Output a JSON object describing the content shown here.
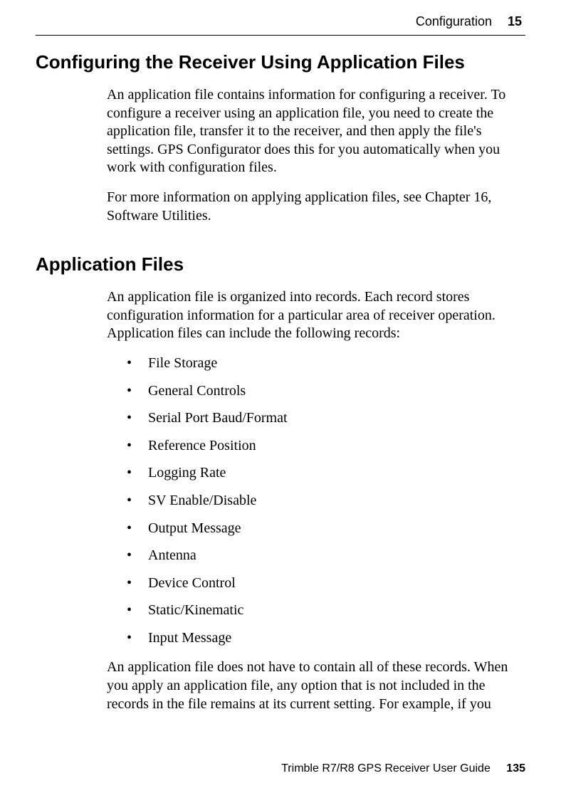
{
  "header": {
    "section": "Configuration",
    "chapter": "15"
  },
  "heading1": "Configuring the Receiver Using Application Files",
  "para1": "An application file contains information for configuring a receiver. To configure a receiver using an application file, you need to create the application file, transfer it to the receiver, and then apply the file's settings. GPS Configurator does this for you automatically when you work with configuration files.",
  "para2": "For more information on applying application files, see Chapter 16, Software Utilities.",
  "heading2": "Application Files",
  "para3": "An application file is organized into records. Each record stores configuration information for a particular area of receiver operation. Application files can include the following records:",
  "records": [
    "File Storage",
    "General Controls",
    "Serial Port Baud/Format",
    "Reference Position",
    "Logging Rate",
    "SV Enable/Disable",
    "Output Message",
    "Antenna",
    "Device Control",
    "Static/Kinematic",
    "Input Message"
  ],
  "para4": "An application file does not have to contain all of these records. When you apply an application file, any option that is not included in the records in the file remains at its current setting. For example, if you",
  "footer": {
    "title": "Trimble R7/R8 GPS Receiver User Guide",
    "page": "135"
  }
}
